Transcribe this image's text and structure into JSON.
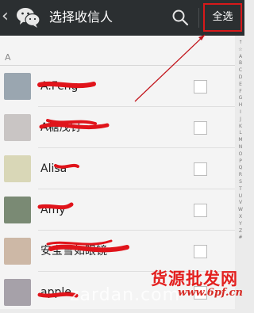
{
  "header": {
    "back_glyph": "‹",
    "title": "选择收信人",
    "select_all_label": "全选"
  },
  "section_header": "A",
  "contacts": [
    {
      "name": "A.Feng",
      "avatar_color": "#9aa6b0"
    },
    {
      "name": "A糖茂钉",
      "avatar_color": "#c9c5c4"
    },
    {
      "name": "Alisa",
      "avatar_color": "#d9d7b7"
    },
    {
      "name": "Amy",
      "avatar_color": "#7a8a74"
    },
    {
      "name": "安宝雪如眼镜",
      "avatar_color": "#cdb8a6"
    },
    {
      "name": "apple",
      "avatar_color": "#a6a1a9"
    }
  ],
  "index_letters": [
    "↑",
    "☆",
    "A",
    "B",
    "C",
    "D",
    "E",
    "F",
    "G",
    "H",
    "I",
    "J",
    "K",
    "L",
    "M",
    "N",
    "O",
    "P",
    "Q",
    "R",
    "S",
    "T",
    "U",
    "V",
    "W",
    "X",
    "Y",
    "Z",
    "#"
  ],
  "watermarks": {
    "site_cn": "货源批发网",
    "site_url": "www.6pf.cn",
    "site_bottom": "zardan.com"
  },
  "colors": {
    "topbar": "#2b2f31",
    "highlight_border": "#d7191a",
    "scribble": "#e0141b",
    "annotation_line": "#c2151c"
  }
}
